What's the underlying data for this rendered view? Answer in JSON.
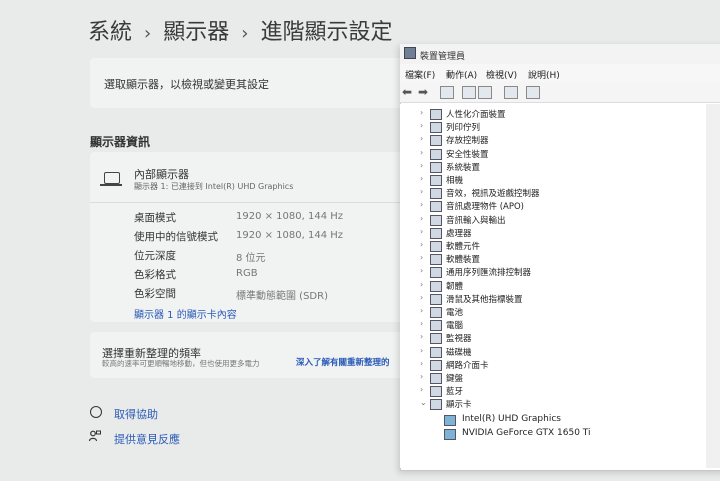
{
  "settings": {
    "breadcrumb": [
      "系統",
      "顯示器",
      "進階顯示設定"
    ],
    "select_display_text": "選取顯示器，以檢視或變更其設定",
    "section_title": "顯示器資訊",
    "display_name": "內部顯示器",
    "display_sub": "顯示器 1: 已連接到 Intel(R) UHD Graphics",
    "rows": [
      {
        "label": "桌面模式",
        "value": "1920 × 1080, 144 Hz"
      },
      {
        "label": "使用中的信號模式",
        "value": "1920 × 1080, 144 Hz"
      },
      {
        "label": "位元深度",
        "value": "8 位元"
      },
      {
        "label": "色彩格式",
        "value": "RGB"
      },
      {
        "label": "色彩空間",
        "value": "標準動態範圍 (SDR)"
      }
    ],
    "adapter_link": "顯示器 1 的顯示卡內容",
    "refresh_title": "選擇重新整理的頻率",
    "refresh_sub": "較高的速率可更順暢地移動，但也使用更多電力",
    "refresh_link": "深入了解有關重新整理的",
    "help_link": "取得協助",
    "feedback_link": "提供意見反應"
  },
  "device_manager": {
    "title": "裝置管理員",
    "menu": [
      "檔案(F)",
      "動作(A)",
      "檢視(V)",
      "說明(H)"
    ],
    "tree": [
      {
        "label": "人性化介面裝置",
        "expanded": false
      },
      {
        "label": "列印佇列",
        "expanded": false
      },
      {
        "label": "存放控制器",
        "expanded": false
      },
      {
        "label": "安全性裝置",
        "expanded": false
      },
      {
        "label": "系統裝置",
        "expanded": false
      },
      {
        "label": "相機",
        "expanded": false
      },
      {
        "label": "音效，視訊及遊戲控制器",
        "expanded": false
      },
      {
        "label": "音訊處理物件 (APO)",
        "expanded": false
      },
      {
        "label": "音訊輸入與輸出",
        "expanded": false
      },
      {
        "label": "處理器",
        "expanded": false
      },
      {
        "label": "軟體元件",
        "expanded": false
      },
      {
        "label": "軟體裝置",
        "expanded": false
      },
      {
        "label": "通用序列匯流排控制器",
        "expanded": false
      },
      {
        "label": "韌體",
        "expanded": false
      },
      {
        "label": "滑鼠及其他指標裝置",
        "expanded": false
      },
      {
        "label": "電池",
        "expanded": false
      },
      {
        "label": "電腦",
        "expanded": false
      },
      {
        "label": "監視器",
        "expanded": false
      },
      {
        "label": "磁碟機",
        "expanded": false
      },
      {
        "label": "網路介面卡",
        "expanded": false
      },
      {
        "label": "鍵盤",
        "expanded": false
      },
      {
        "label": "藍牙",
        "expanded": false
      },
      {
        "label": "顯示卡",
        "expanded": true
      }
    ],
    "display_adapters": [
      "Intel(R) UHD Graphics",
      "NVIDIA GeForce GTX 1650 Ti"
    ]
  }
}
